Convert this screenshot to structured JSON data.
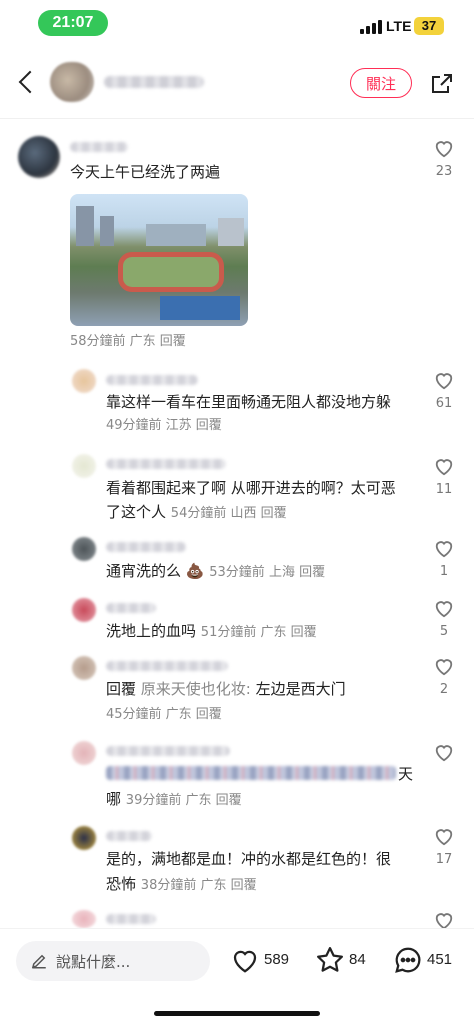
{
  "status": {
    "time": "21:07",
    "network": "LTE",
    "battery": "37"
  },
  "header": {
    "follow_label": "關注"
  },
  "comments": [
    {
      "text": "今天上午已经洗了两遍",
      "meta": "58分鐘前 广东 回覆",
      "likes": "23"
    }
  ],
  "replies": [
    {
      "text": "靠这样一看车在里面畅通无阻人都没地方躲",
      "meta": "49分鐘前 江苏 回覆",
      "likes": "61"
    },
    {
      "text_line1": "看着都围起来了啊 从哪开进去的啊？太可恶",
      "text_line2": "了这个人",
      "meta": "54分鐘前 山西 回覆",
      "likes": "11"
    },
    {
      "text": "通宵洗的么",
      "emoji": "💩",
      "meta": "53分鐘前 上海 回覆",
      "likes": "1"
    },
    {
      "text": "洗地上的血吗",
      "meta": "51分鐘前 广东 回覆",
      "likes": "5"
    },
    {
      "reply_label": "回覆",
      "reply_target": "原来天使也化妆:",
      "text": "左边是西大门",
      "meta": "45分鐘前 广东 回覆",
      "likes": "2"
    },
    {
      "text_tail": "天",
      "text_line2": "哪",
      "meta": "39分鐘前 广东 回覆",
      "likes": ""
    },
    {
      "text_line1": "是的，满地都是血！冲的水都是红色的！很",
      "text_line2": "恐怖",
      "meta": "38分鐘前 广东 回覆",
      "likes": "17"
    }
  ],
  "bottom": {
    "input_placeholder": "說點什麼...",
    "likes": "589",
    "favorites": "84",
    "comments": "451"
  },
  "colors": {
    "accent": "#ff2e55",
    "status_pill": "#34c759",
    "battery": "#f3d23b"
  },
  "icons": [
    "back-icon",
    "share-icon",
    "heart-icon",
    "star-icon",
    "comment-icon",
    "pen-icon"
  ]
}
